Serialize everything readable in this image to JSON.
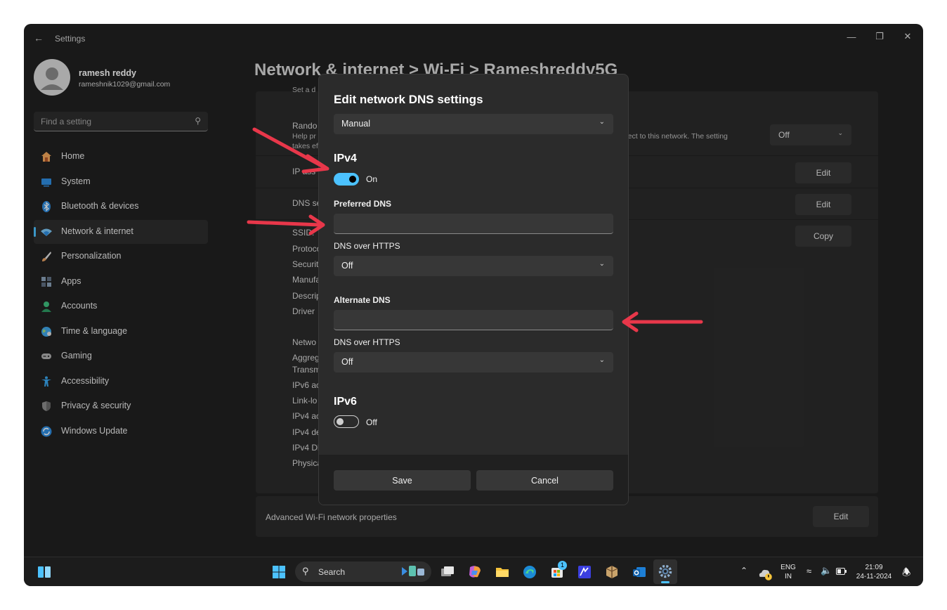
{
  "window": {
    "app_title": "Settings"
  },
  "profile": {
    "name": "ramesh reddy",
    "email": "rameshnik1029@gmail.com"
  },
  "search": {
    "placeholder": "Find a setting"
  },
  "sidebar": {
    "items": [
      {
        "label": "Home",
        "icon": "home-icon",
        "color": "#f2a65a"
      },
      {
        "label": "System",
        "icon": "system-icon",
        "color": "#2f8ee0"
      },
      {
        "label": "Bluetooth & devices",
        "icon": "bluetooth-icon",
        "color": "#2f8ee0"
      },
      {
        "label": "Network & internet",
        "icon": "network-icon",
        "color": "#7cc6f5",
        "active": true
      },
      {
        "label": "Personalization",
        "icon": "brush-icon",
        "color": "#e8a264"
      },
      {
        "label": "Apps",
        "icon": "apps-icon",
        "color": "#8aa0b8"
      },
      {
        "label": "Accounts",
        "icon": "accounts-icon",
        "color": "#3fc07f"
      },
      {
        "label": "Time & language",
        "icon": "globe-icon",
        "color": "#3fa6e8"
      },
      {
        "label": "Gaming",
        "icon": "gamepad-icon",
        "color": "#b0b0b0"
      },
      {
        "label": "Accessibility",
        "icon": "accessibility-icon",
        "color": "#39a7f0"
      },
      {
        "label": "Privacy & security",
        "icon": "shield-icon",
        "color": "#8c8c8c"
      },
      {
        "label": "Windows Update",
        "icon": "update-icon",
        "color": "#2f8ee0"
      }
    ]
  },
  "main": {
    "breadcrumb": "Network & internet  >  Wi-Fi  >  Rameshreddy5G",
    "top_fragment": "Set a d",
    "random_label": "Rando",
    "random_desc_1": "Help pr",
    "random_desc_2": "takes ef",
    "random_desc_right": "nnect to this network. The setting",
    "random_value": "Off",
    "ip_label": "IP ass",
    "dns_label": "DNS se",
    "edit_label": "Edit",
    "copy_label": "Copy",
    "props": [
      "SSID:",
      "Protoco",
      "Securit",
      "Manufa",
      "Descrip",
      "Driver"
    ],
    "props2": [
      "Netwo",
      "Aggreg",
      "Transm",
      "IPv6 ac",
      "Link-lo",
      "IPv4 ac",
      "IPv4 de",
      "IPv4 Dl",
      "Physica"
    ],
    "advanced_label": "Advanced Wi-Fi network properties",
    "advanced_button": "Edit"
  },
  "dialog": {
    "title": "Edit network DNS settings",
    "mode": "Manual",
    "ipv4": {
      "heading": "IPv4",
      "toggle_state": "On"
    },
    "preferred_dns": {
      "label": "Preferred DNS",
      "value": ""
    },
    "preferred_https": {
      "label": "DNS over HTTPS",
      "value": "Off"
    },
    "alternate_dns": {
      "label": "Alternate DNS",
      "value": ""
    },
    "alternate_https": {
      "label": "DNS over HTTPS",
      "value": "Off"
    },
    "ipv6": {
      "heading": "IPv6",
      "toggle_state": "Off"
    },
    "save": "Save",
    "cancel": "Cancel"
  },
  "taskbar": {
    "search_label": "Search",
    "badge_count": "1",
    "lang_top": "ENG",
    "lang_bottom": "IN",
    "time": "21:09",
    "date": "24-11-2024"
  },
  "colors": {
    "accent": "#4cc2ff",
    "annotation_arrow": "#e8374a"
  }
}
